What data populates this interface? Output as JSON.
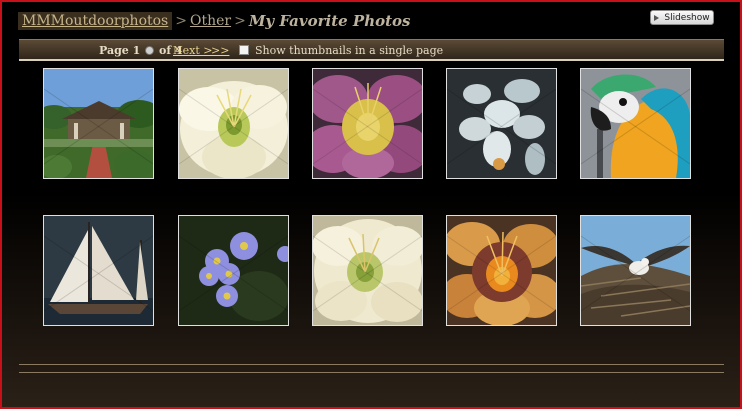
{
  "breadcrumb": {
    "home": "MMMoutdoorphotos",
    "separator": ">",
    "category": "Other",
    "current": "My Favorite Photos"
  },
  "slideshow_label": "Slideshow",
  "pager": {
    "page_prefix": "Page",
    "current_page": "1",
    "of_text": "of 4",
    "next_label": "Next >",
    "last_label": ">>",
    "single_page_label": "Show thumbnails in a single page",
    "single_page_checked": false
  },
  "thumbnails": [
    {
      "subject": "gazebo-brick-path"
    },
    {
      "subject": "cream-daylily"
    },
    {
      "subject": "purple-daylily"
    },
    {
      "subject": "white-orchid"
    },
    {
      "subject": "blue-gold-macaw"
    },
    {
      "subject": "sailboat"
    },
    {
      "subject": "purple-asters"
    },
    {
      "subject": "cream-daylily-2"
    },
    {
      "subject": "orange-daylily"
    },
    {
      "subject": "osprey-nest"
    }
  ],
  "colors": {
    "frame_border": "#c8101a",
    "breadcrumb_highlight": "#3a2f1e",
    "nav_bar": "#5b4a35",
    "link": "#e6d18e"
  }
}
